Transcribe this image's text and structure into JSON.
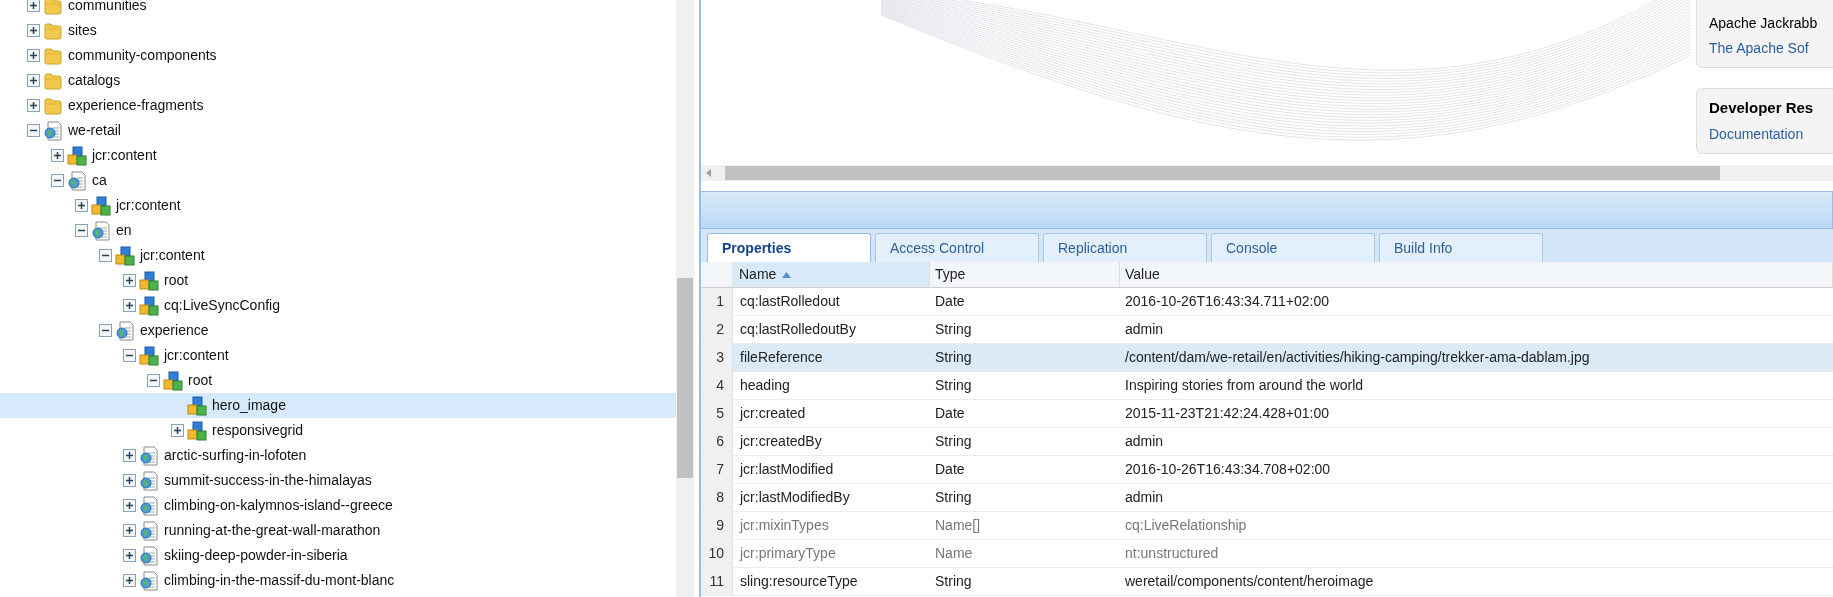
{
  "tree": [
    {
      "label": "communities",
      "kind": "folder",
      "expanded": false,
      "selected": false
    },
    {
      "label": "sites",
      "kind": "folder",
      "expanded": false,
      "selected": false
    },
    {
      "label": "community-components",
      "kind": "folder",
      "expanded": false,
      "selected": false
    },
    {
      "label": "catalogs",
      "kind": "folder",
      "expanded": false,
      "selected": false
    },
    {
      "label": "experience-fragments",
      "kind": "folder",
      "expanded": false,
      "selected": false
    },
    {
      "label": "we-retail",
      "kind": "page",
      "expanded": true,
      "selected": false,
      "children": [
        {
          "label": "jcr:content",
          "kind": "node",
          "expanded": false,
          "selected": false
        },
        {
          "label": "ca",
          "kind": "page",
          "expanded": true,
          "selected": false,
          "children": [
            {
              "label": "jcr:content",
              "kind": "node",
              "expanded": false,
              "selected": false
            },
            {
              "label": "en",
              "kind": "page",
              "expanded": true,
              "selected": false,
              "children": [
                {
                  "label": "jcr:content",
                  "kind": "node",
                  "expanded": true,
                  "selected": false,
                  "children": [
                    {
                      "label": "root",
                      "kind": "node",
                      "expanded": false,
                      "selected": false
                    },
                    {
                      "label": "cq:LiveSyncConfig",
                      "kind": "node",
                      "expanded": false,
                      "selected": false
                    }
                  ]
                },
                {
                  "label": "experience",
                  "kind": "page",
                  "expanded": true,
                  "selected": false,
                  "children": [
                    {
                      "label": "jcr:content",
                      "kind": "node",
                      "expanded": true,
                      "selected": false,
                      "children": [
                        {
                          "label": "root",
                          "kind": "node",
                          "expanded": true,
                          "selected": false,
                          "children": [
                            {
                              "label": "hero_image",
                              "kind": "node",
                              "selected": true
                            },
                            {
                              "label": "responsivegrid",
                              "kind": "node",
                              "expanded": false,
                              "selected": false
                            }
                          ]
                        }
                      ]
                    },
                    {
                      "label": "arctic-surfing-in-lofoten",
                      "kind": "page",
                      "expanded": false,
                      "selected": false
                    },
                    {
                      "label": "summit-success-in-the-himalayas",
                      "kind": "page",
                      "expanded": false,
                      "selected": false
                    },
                    {
                      "label": "climbing-on-kalymnos-island--greece",
                      "kind": "page",
                      "expanded": false,
                      "selected": false
                    },
                    {
                      "label": "running-at-the-great-wall-marathon",
                      "kind": "page",
                      "expanded": false,
                      "selected": false
                    },
                    {
                      "label": "skiing-deep-powder-in-siberia",
                      "kind": "page",
                      "expanded": false,
                      "selected": false
                    },
                    {
                      "label": "climbing-in-the-massif-du-mont-blanc",
                      "kind": "page",
                      "expanded": false,
                      "selected": false
                    }
                  ]
                }
              ]
            }
          ]
        }
      ]
    }
  ],
  "welcome_cards": [
    {
      "lines": [
        {
          "kind": "text",
          "text": "Apache Jackrabb"
        },
        {
          "kind": "link",
          "text": "The Apache Sof"
        }
      ]
    },
    {
      "title": "Developer Res",
      "lines": [
        {
          "kind": "link",
          "text": "Documentation"
        }
      ]
    }
  ],
  "tabs": [
    {
      "label": "Properties",
      "selected": true
    },
    {
      "label": "Access Control",
      "selected": false
    },
    {
      "label": "Replication",
      "selected": false
    },
    {
      "label": "Console",
      "selected": false
    },
    {
      "label": "Build Info",
      "selected": false
    }
  ],
  "table": {
    "columns": [
      {
        "label": "Name",
        "sorted": true
      },
      {
        "label": "Type"
      },
      {
        "label": "Value"
      }
    ],
    "rows": [
      {
        "number": "1",
        "name": "cq:lastRolledout",
        "type": "Date",
        "value": "2016-10-26T16:43:34.711+02:00",
        "protected": false,
        "selected": false
      },
      {
        "number": "2",
        "name": "cq:lastRolledoutBy",
        "type": "String",
        "value": "admin",
        "protected": false,
        "selected": false
      },
      {
        "number": "3",
        "name": "fileReference",
        "type": "String",
        "value": "/content/dam/we-retail/en/activities/hiking-camping/trekker-ama-dablam.jpg",
        "protected": false,
        "selected": true
      },
      {
        "number": "4",
        "name": "heading",
        "type": "String",
        "value": "Inspiring stories from around the world",
        "protected": false,
        "selected": false
      },
      {
        "number": "5",
        "name": "jcr:created",
        "type": "Date",
        "value": "2015-11-23T21:42:24.428+01:00",
        "protected": false,
        "selected": false
      },
      {
        "number": "6",
        "name": "jcr:createdBy",
        "type": "String",
        "value": "admin",
        "protected": false,
        "selected": false
      },
      {
        "number": "7",
        "name": "jcr:lastModified",
        "type": "Date",
        "value": "2016-10-26T16:43:34.708+02:00",
        "protected": false,
        "selected": false
      },
      {
        "number": "8",
        "name": "jcr:lastModifiedBy",
        "type": "String",
        "value": "admin",
        "protected": false,
        "selected": false
      },
      {
        "number": "9",
        "name": "jcr:mixinTypes",
        "type": "Name[]",
        "value": "cq:LiveRelationship",
        "protected": true,
        "selected": false
      },
      {
        "number": "10",
        "name": "jcr:primaryType",
        "type": "Name",
        "value": "nt:unstructured",
        "protected": true,
        "selected": false
      },
      {
        "number": "11",
        "name": "sling:resourceType",
        "type": "String",
        "value": "weretail/components/content/heroimage",
        "protected": false,
        "selected": false
      }
    ]
  }
}
